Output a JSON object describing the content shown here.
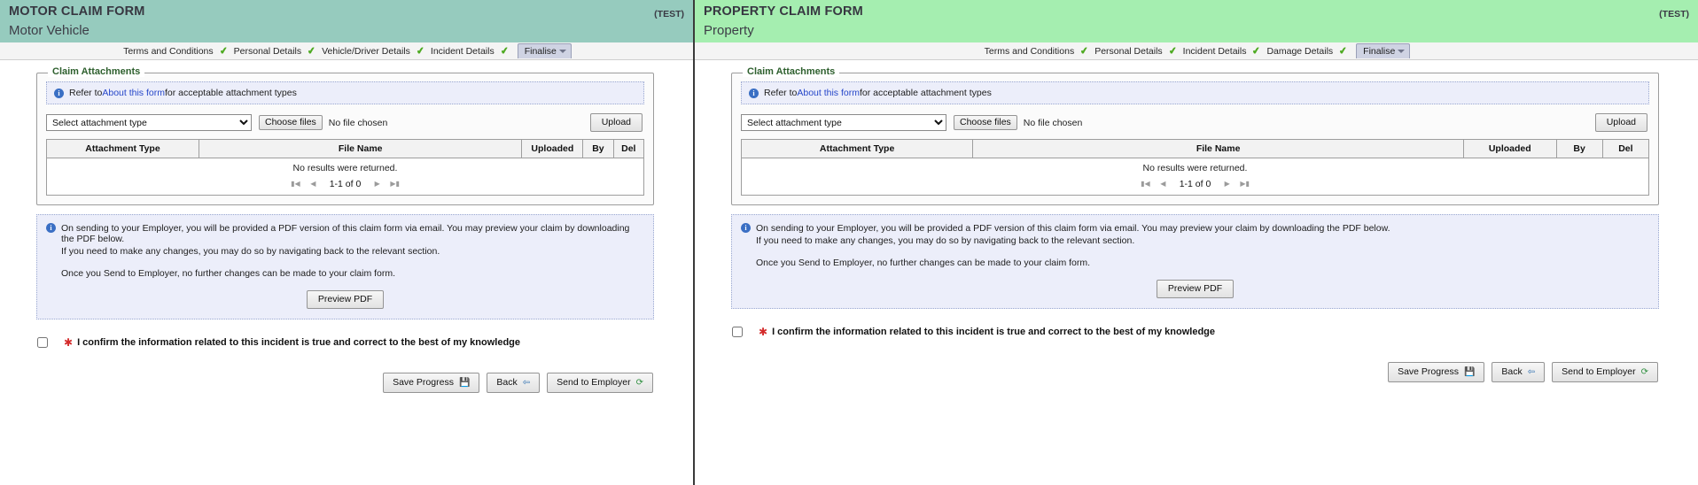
{
  "panes": [
    {
      "key": "motor",
      "header": {
        "title": "MOTOR CLAIM FORM",
        "subtitle": "Motor Vehicle",
        "env_tag": "(TEST)",
        "bg_color": "#96cbbe"
      },
      "steps": [
        {
          "label": "Terms and Conditions",
          "complete": true
        },
        {
          "label": "Personal Details",
          "complete": true
        },
        {
          "label": "Vehicle/Driver Details",
          "complete": true
        },
        {
          "label": "Incident Details",
          "complete": true
        }
      ],
      "current_step": "Finalise"
    },
    {
      "key": "property",
      "header": {
        "title": "PROPERTY CLAIM FORM",
        "subtitle": "Property",
        "env_tag": "(TEST)",
        "bg_color": "#a5eeb0"
      },
      "steps": [
        {
          "label": "Terms and Conditions",
          "complete": true
        },
        {
          "label": "Personal Details",
          "complete": true
        },
        {
          "label": "Incident Details",
          "complete": true
        },
        {
          "label": "Damage Details",
          "complete": true
        }
      ],
      "current_step": "Finalise"
    }
  ],
  "attachments": {
    "legend": "Claim Attachments",
    "info_prefix": "Refer to ",
    "info_link": "About this form",
    "info_suffix": " for acceptable attachment types",
    "select_value": "Select attachment type",
    "select_options": [
      "Select attachment type"
    ],
    "choose_files_label": "Choose files",
    "no_file_text": "No file chosen",
    "upload_label": "Upload",
    "columns": [
      "Attachment Type",
      "File Name",
      "Uploaded",
      "By",
      "Del"
    ],
    "rows": [],
    "empty_message": "No results were returned.",
    "pager": {
      "first": "⏮",
      "prev": "◀",
      "text": "1-1 of 0",
      "next": "▶",
      "last": "⏭"
    }
  },
  "pdf_notice": {
    "line1": "On sending to your Employer, you will be provided a PDF version of this claim form via email. You may preview your claim by downloading the PDF below.",
    "line2": "If you need to make any changes, you may do so by navigating back to the relevant section.",
    "line3": "Once you Send to Employer, no further changes can be made to your claim form.",
    "preview_button": "Preview PDF"
  },
  "confirm": {
    "required_marker": "✱",
    "label": "I confirm the information related to this incident is true and correct to the best of my knowledge",
    "checked": false
  },
  "actions": {
    "save": {
      "label": "Save Progress",
      "icon": "💾"
    },
    "back": {
      "label": "Back",
      "icon": "⇦"
    },
    "send": {
      "label": "Send to Employer",
      "icon": "⟳"
    }
  },
  "colors": {
    "motor_header": "#96cbbe",
    "property_header": "#a5eeb0",
    "info_panel": "#eceefa",
    "tick_green": "#4eaa22",
    "link_blue": "#2647c9",
    "required_red": "#d42b2b"
  }
}
